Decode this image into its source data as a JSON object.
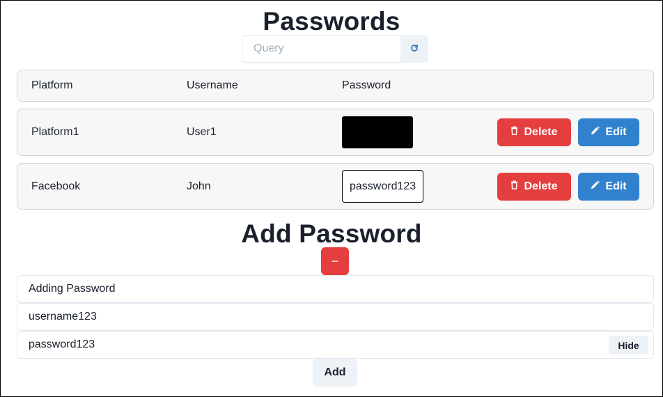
{
  "header": {
    "title": "Passwords"
  },
  "search": {
    "placeholder": "Query",
    "value": ""
  },
  "refresh": {
    "icon": "refresh-icon",
    "color": "#2b6cb0"
  },
  "table": {
    "columns": [
      "Platform",
      "Username",
      "Password"
    ],
    "rows": [
      {
        "platform": "Platform1",
        "username": "User1",
        "password_visible": false,
        "delete_label": "Delete",
        "edit_label": "Edit"
      },
      {
        "platform": "Facebook",
        "username": "John",
        "password": "password123",
        "password_visible": true,
        "delete_label": "Delete",
        "edit_label": "Edit"
      }
    ]
  },
  "add_section": {
    "title": "Add Password",
    "collapse_symbol": "−",
    "platform_value": "Adding Password",
    "username_value": "username123",
    "password_value": "password123",
    "hide_label": "Hide",
    "add_label": "Add"
  },
  "colors": {
    "delete": "#e53e3e",
    "edit": "#3182ce",
    "neutral": "#edf2f7"
  }
}
